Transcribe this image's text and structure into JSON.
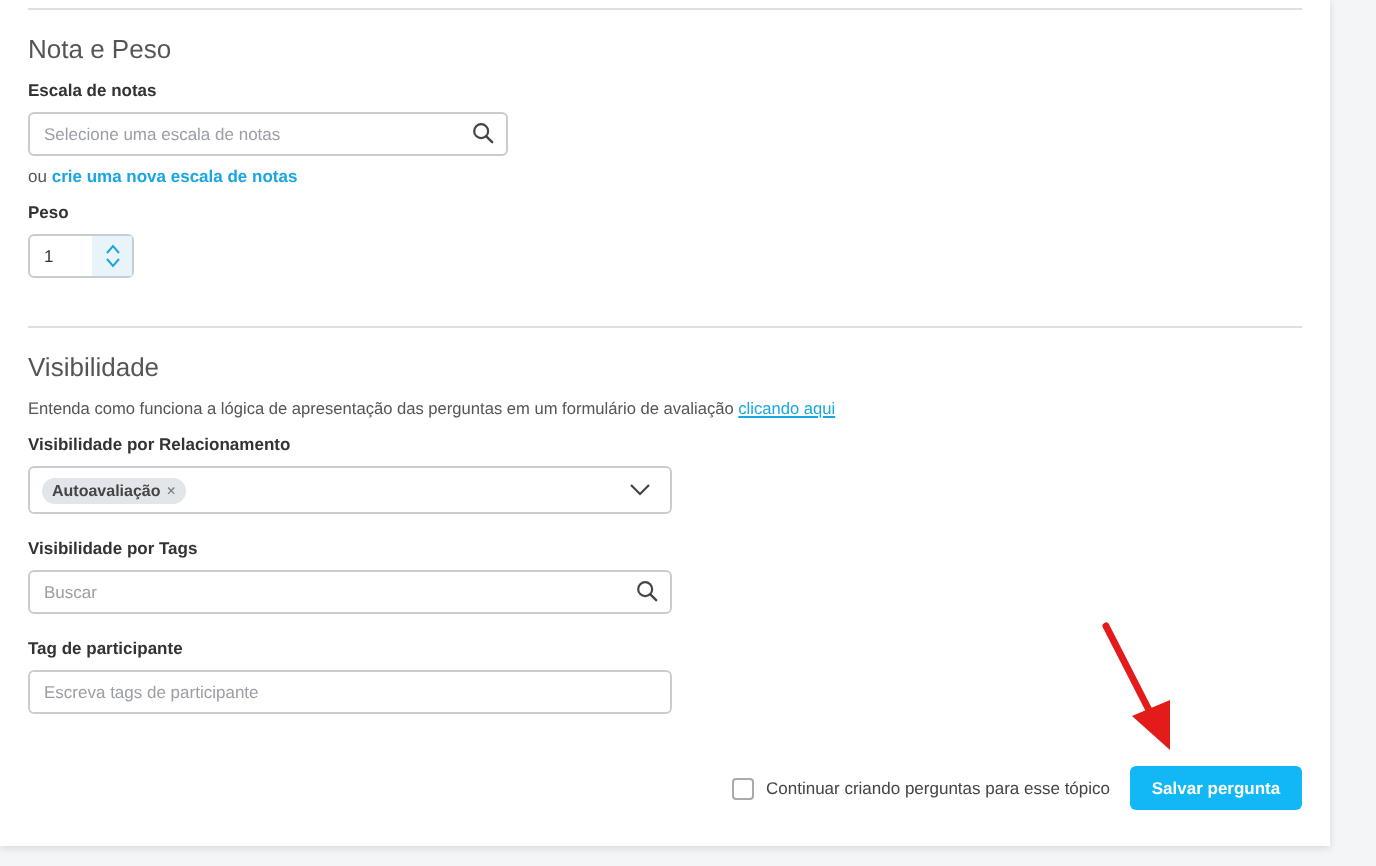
{
  "sections": [
    {
      "title": "Nota e Peso",
      "fields": [
        {
          "kind": "search",
          "label": "Escala de notas",
          "placeholder": "Selecione uma escala de notas"
        },
        {
          "kind": "link-line",
          "prefix": "ou",
          "link": "crie uma nova escala de notas"
        },
        {
          "kind": "number",
          "label": "Peso",
          "value": "1"
        }
      ]
    },
    {
      "title": "Visibilidade",
      "description": "Entenda como funciona a lógica de apresentação das perguntas em um formulário de avaliação",
      "description_link": "clicando aqui",
      "fields": [
        {
          "kind": "multiselect",
          "label": "Visibilidade por Relacionamento",
          "chips": [
            {
              "label": "Autoavaliação",
              "remove": "×"
            }
          ]
        },
        {
          "kind": "search",
          "label": "Visibilidade por Tags",
          "placeholder": "Buscar"
        },
        {
          "kind": "text",
          "label": "Tag de participante",
          "placeholder": "Escreva tags de participante"
        }
      ]
    }
  ],
  "footer": {
    "checkbox": {
      "label": "Continuar criando perguntas para esse tópico",
      "checked": false
    },
    "save_button": "Salvar pergunta"
  }
}
